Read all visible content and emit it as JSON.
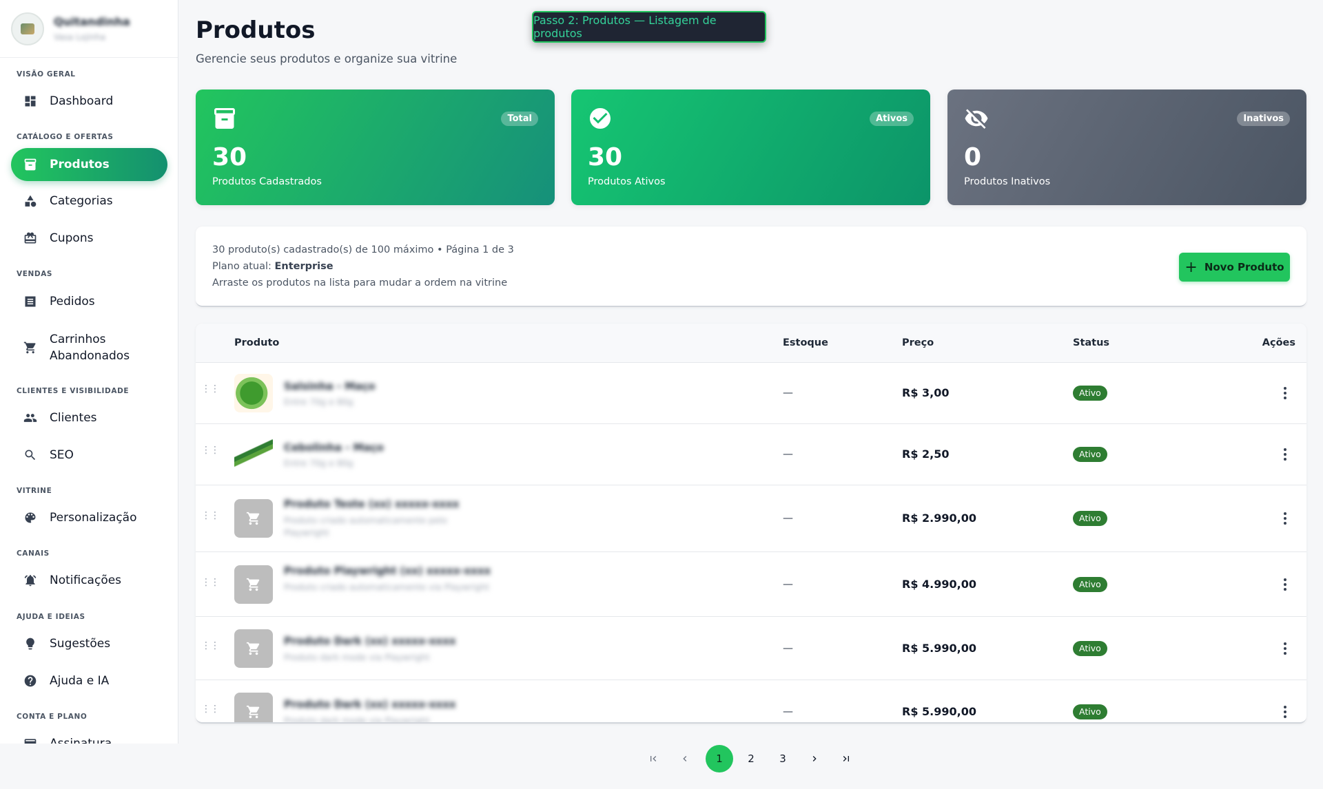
{
  "brand": {
    "name": "Quitandinha",
    "subtitle": "Vasa Lojinha"
  },
  "sidebar": {
    "sections": [
      {
        "label": "VISÃO GERAL"
      },
      {
        "label": "CATÁLOGO E OFERTAS"
      },
      {
        "label": "VENDAS"
      },
      {
        "label": "CLIENTES E VISIBILIDADE"
      },
      {
        "label": "VITRINE"
      },
      {
        "label": "CANAIS"
      },
      {
        "label": "AJUDA E IDEIAS"
      },
      {
        "label": "CONTA E PLANO"
      }
    ],
    "items": [
      {
        "label": "Dashboard",
        "icon": "dashboard-icon"
      },
      {
        "label": "Produtos",
        "icon": "archive-icon",
        "active": true
      },
      {
        "label": "Categorias",
        "icon": "category-icon"
      },
      {
        "label": "Cupons",
        "icon": "gift-card-icon"
      },
      {
        "label": "Pedidos",
        "icon": "list-alt-icon"
      },
      {
        "label": "Carrinhos",
        "label2": "Abandonados",
        "icon": "cart-icon"
      },
      {
        "label": "Clientes",
        "icon": "people-icon"
      },
      {
        "label": "SEO",
        "icon": "search-icon"
      },
      {
        "label": "Personalização",
        "icon": "palette-icon"
      },
      {
        "label": "Notificações",
        "icon": "bell-icon"
      },
      {
        "label": "Sugestões",
        "icon": "lightbulb-icon"
      },
      {
        "label": "Ajuda e IA",
        "icon": "help-icon"
      },
      {
        "label": "Assinatura",
        "icon": "credit-card-icon"
      }
    ]
  },
  "header": {
    "title": "Produtos",
    "subtitle": "Gerencie seus produtos e organize sua vitrine",
    "step_tooltip": "Passo 2: Produtos — Listagem de produtos"
  },
  "stats": [
    {
      "badge": "Total",
      "value": "30",
      "caption": "Produtos Cadastrados",
      "icon": "archive-icon"
    },
    {
      "badge": "Ativos",
      "value": "30",
      "caption": "Produtos Ativos",
      "icon": "check-circle-icon"
    },
    {
      "badge": "Inativos",
      "value": "0",
      "caption": "Produtos Inativos",
      "icon": "eye-off-icon"
    }
  ],
  "info": {
    "line1": "30 produto(s) cadastrado(s) de 100 máximo • Página 1 de 3",
    "plan_prefix": "Plano atual: ",
    "plan_name": "Enterprise",
    "line3": "Arraste os produtos na lista para mudar a ordem na vitrine",
    "new_button": "Novo Produto"
  },
  "table": {
    "columns": {
      "product": "Produto",
      "stock": "Estoque",
      "price": "Preço",
      "status": "Status",
      "actions": "Ações"
    },
    "rows": [
      {
        "name": "Salsinha - Maço",
        "desc": "Entre 70g e 80g",
        "stock": "—",
        "price": "R$ 3,00",
        "status": "Ativo"
      },
      {
        "name": "Cebolinha - Maço",
        "desc": "Entre 70g e 80g",
        "stock": "—",
        "price": "R$ 2,50",
        "status": "Ativo"
      },
      {
        "name": "Produto Teste (xx) xxxxx-xxxx",
        "desc": "Produto criado automaticamente pelo Playwright",
        "stock": "—",
        "price": "R$ 2.990,00",
        "status": "Ativo"
      },
      {
        "name": "Produto Playwright (xx) xxxxx-xxxx",
        "desc": "Produto criado automaticamente via Playwright",
        "stock": "—",
        "price": "R$ 4.990,00",
        "status": "Ativo"
      },
      {
        "name": "Produto Dark (xx) xxxxx-xxxx",
        "desc": "Produto dark mode via Playwright",
        "stock": "—",
        "price": "R$ 5.990,00",
        "status": "Ativo"
      },
      {
        "name": "Produto Dark (xx) xxxxx-xxxx",
        "desc": "Produto dark mode via Playwright",
        "stock": "—",
        "price": "R$ 5.990,00",
        "status": "Ativo"
      }
    ]
  },
  "pagination": {
    "pages": [
      "1",
      "2",
      "3"
    ],
    "current": "1"
  },
  "colors": {
    "accent": "#22c55e",
    "accent_dark": "#14906f",
    "status_active": "#2e7d32",
    "inactive_card": "#6b7280"
  }
}
